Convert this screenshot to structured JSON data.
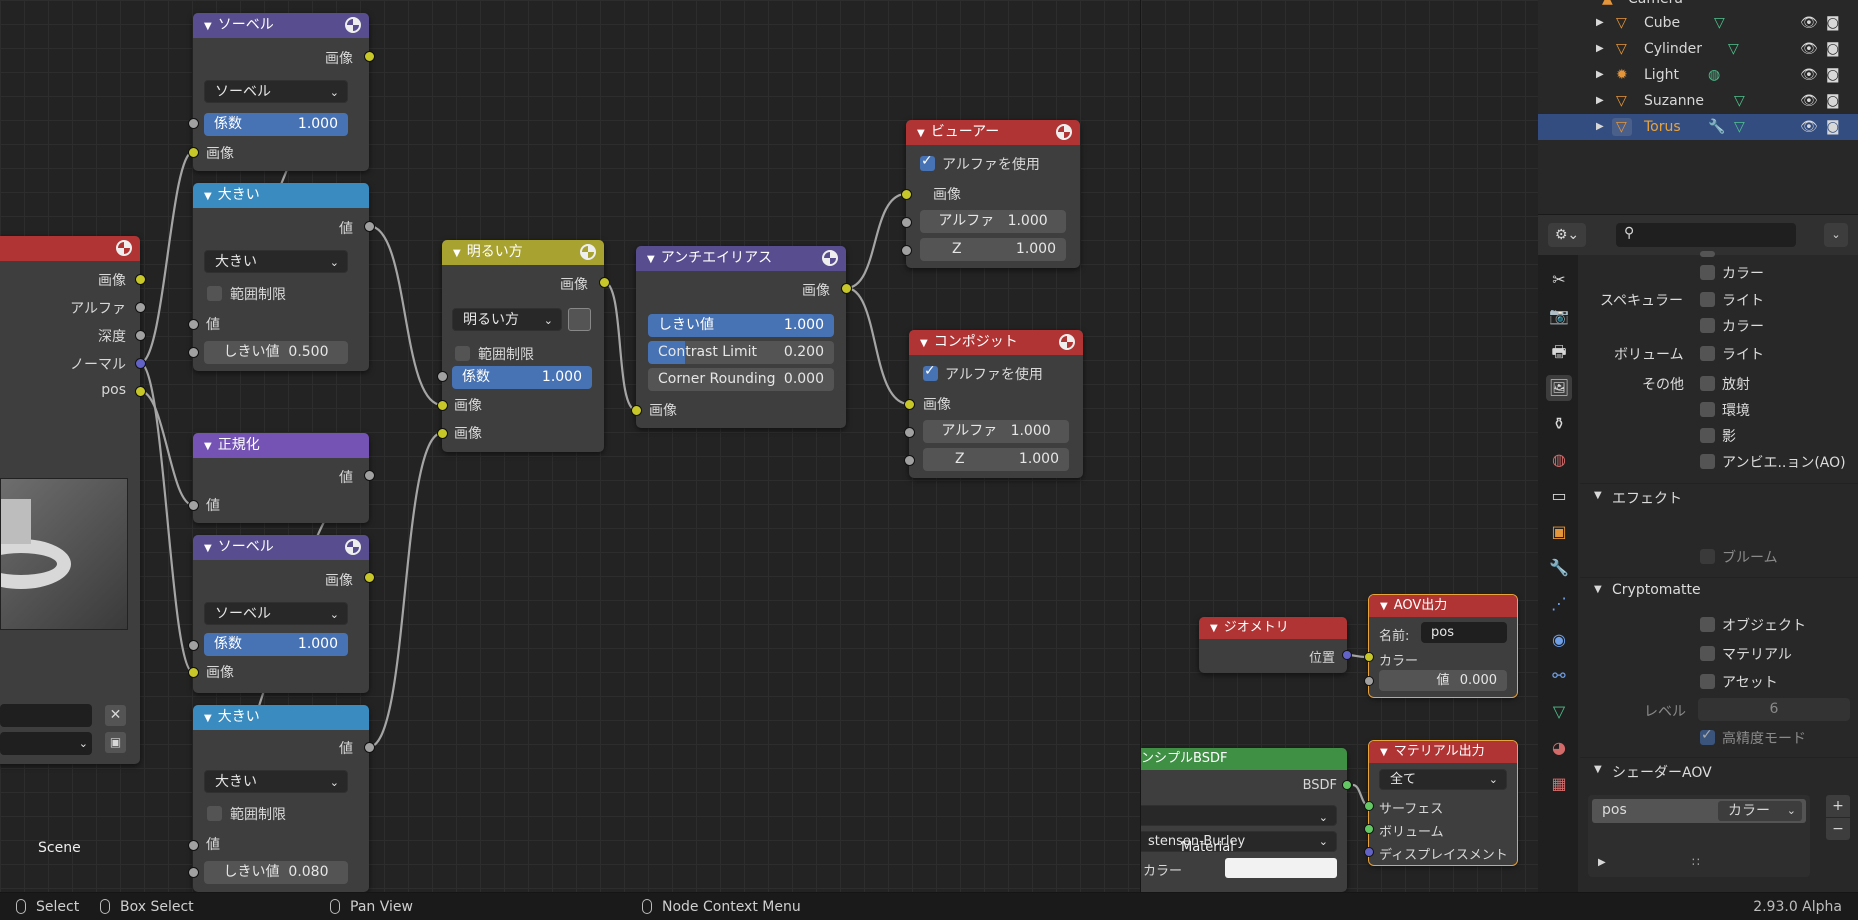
{
  "compositor": {
    "render_layers": {
      "outputs": [
        "画像",
        "アルファ",
        "深度",
        "ノーマル",
        "pos"
      ],
      "scene_label": "Scene"
    },
    "sobel1": {
      "title": "ソーベル",
      "out": "画像",
      "filter": "ソーベル",
      "fac_label": "係数",
      "fac_value": "1.000",
      "in": "画像"
    },
    "greater1": {
      "title": "大きい",
      "out": "値",
      "op": "大きい",
      "clamp": "範囲制限",
      "in": "値",
      "thr_label": "しきい値",
      "thr_value": "0.500"
    },
    "normalize": {
      "title": "正規化",
      "out": "値",
      "in": "値"
    },
    "sobel2": {
      "title": "ソーベル",
      "out": "画像",
      "filter": "ソーベル",
      "fac_label": "係数",
      "fac_value": "1.000",
      "in": "画像"
    },
    "greater2": {
      "title": "大きい",
      "out": "値",
      "op": "大きい",
      "clamp": "範囲制限",
      "in": "値",
      "thr_label": "しきい値",
      "thr_value": "0.080"
    },
    "lighten": {
      "title": "明るい方",
      "out": "画像",
      "mode": "明るい方",
      "clamp": "範囲制限",
      "fac_label": "係数",
      "fac_value": "1.000",
      "in1": "画像",
      "in2": "画像"
    },
    "antialias": {
      "title": "アンチエイリアス",
      "out": "画像",
      "thr_label": "しきい値",
      "thr_value": "1.000",
      "cl_label": "Contrast Limit",
      "cl_value": "0.200",
      "cr_label": "Corner Rounding",
      "cr_value": "0.000",
      "in": "画像"
    },
    "viewer": {
      "title": "ビューアー",
      "alpha_use": "アルファを使用",
      "in_image": "画像",
      "alpha_label": "アルファ",
      "alpha_value": "1.000",
      "z_label": "Z",
      "z_value": "1.000"
    },
    "composite": {
      "title": "コンポジット",
      "alpha_use": "アルファを使用",
      "in_image": "画像",
      "alpha_label": "アルファ",
      "alpha_value": "1.000",
      "z_label": "Z",
      "z_value": "1.000"
    }
  },
  "shader": {
    "geometry": {
      "title": "ジオメトリ",
      "out": "位置"
    },
    "aov": {
      "title": "AOV出力",
      "name_label": "名前:",
      "name_value": "pos",
      "color": "カラー",
      "val_label": "値",
      "val_value": "0.000"
    },
    "bsdf": {
      "title": "ンシプルBSDF",
      "out": "BSDF",
      "dist": "stensen-Burley",
      "color": "カラー"
    },
    "matout": {
      "title": "マテリアル出力",
      "target": "全て",
      "surface": "サーフェス",
      "volume": "ボリューム",
      "disp": "ディスプレイスメント"
    },
    "material_label": "Material"
  },
  "outliner": {
    "items": [
      {
        "name": "Camera"
      },
      {
        "name": "Cube"
      },
      {
        "name": "Cylinder"
      },
      {
        "name": "Light"
      },
      {
        "name": "Suzanne"
      },
      {
        "name": "Torus",
        "selected": true
      }
    ]
  },
  "properties": {
    "search_placeholder": "",
    "rows": {
      "color1": "カラー",
      "spec_label": "スペキュラー",
      "spec_light": "ライト",
      "spec_color": "カラー",
      "vol_label": "ボリューム",
      "vol_light": "ライト",
      "other_label": "その他",
      "emit": "放射",
      "env": "環境",
      "shadow": "影",
      "ao": "アンビエ..ョン(AO)"
    },
    "effects_title": "エフェクト",
    "bloom": "ブルーム",
    "crypto_title": "Cryptomatte",
    "crypto_object": "オブジェクト",
    "crypto_material": "マテリアル",
    "crypto_asset": "アセット",
    "level_label": "レベル",
    "level_value": "6",
    "accurate": "高精度モード",
    "aov_title": "シェーダーAOV",
    "aov_name": "pos",
    "aov_type": "カラー"
  },
  "statusbar": {
    "select": "Select",
    "box_select": "Box Select",
    "pan_view": "Pan View",
    "node_menu": "Node Context Menu",
    "version": "2.93.0 Alpha"
  },
  "colors": {
    "accent": "#4772b3",
    "selected_row": "#334d80",
    "highlight_text": "#e8a33d"
  }
}
